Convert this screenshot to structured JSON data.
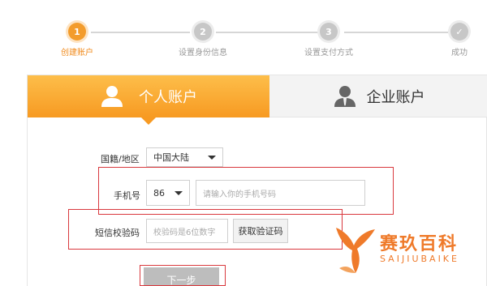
{
  "steps": [
    {
      "num": "1",
      "label": "创建账户",
      "state": "active"
    },
    {
      "num": "2",
      "label": "设置身份信息",
      "state": "pending"
    },
    {
      "num": "3",
      "label": "设置支付方式",
      "state": "pending"
    },
    {
      "num": "✓",
      "label": "成功",
      "state": "pending"
    }
  ],
  "tabs": {
    "personal": {
      "label": "个人账户",
      "icon": "user-icon",
      "selected": true
    },
    "business": {
      "label": "企业账户",
      "icon": "businessman-icon",
      "selected": false
    }
  },
  "form": {
    "region": {
      "label": "国籍/地区",
      "value": "中国大陆"
    },
    "phone": {
      "label": "手机号",
      "code": "86",
      "placeholder": "请输入你的手机号码",
      "value": ""
    },
    "sms": {
      "label": "短信校验码",
      "placeholder": "校验码是6位数字",
      "value": "",
      "button": "获取验证码"
    },
    "next_button": "下一步"
  },
  "watermark": {
    "name": "赛玖百科",
    "sub": "SAIJIUBAIKE"
  },
  "colors": {
    "accent": "#f79a22",
    "annotation": "#d9393e"
  }
}
